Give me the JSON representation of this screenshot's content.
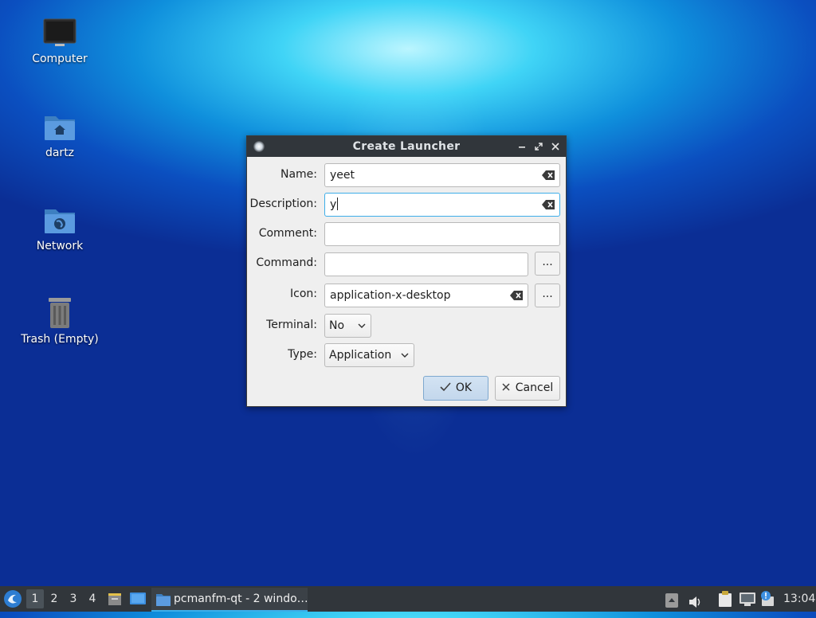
{
  "desktop": {
    "icons": [
      {
        "label": "Computer",
        "icon": "monitor-icon"
      },
      {
        "label": "dartz",
        "icon": "home-folder-icon"
      },
      {
        "label": "Network",
        "icon": "network-folder-icon"
      },
      {
        "label": "Trash (Empty)",
        "icon": "trash-icon"
      }
    ]
  },
  "dialog": {
    "title": "Create Launcher",
    "fields": {
      "name": {
        "label": "Name:",
        "value": "yeet"
      },
      "description": {
        "label": "Description:",
        "value": "y"
      },
      "comment": {
        "label": "Comment:",
        "value": ""
      },
      "command": {
        "label": "Command:",
        "value": "",
        "browse": "..."
      },
      "icon": {
        "label": "Icon:",
        "value": "application-x-desktop",
        "browse": "..."
      },
      "terminal": {
        "label": "Terminal:",
        "value": "No"
      },
      "type": {
        "label": "Type:",
        "value": "Application"
      }
    },
    "buttons": {
      "ok": "OK",
      "cancel": "Cancel"
    }
  },
  "taskbar": {
    "workspaces": [
      "1",
      "2",
      "3",
      "4"
    ],
    "active_workspace": "1",
    "task": "pcmanfm-qt - 2 windo…",
    "clock": "13:04"
  },
  "colors": {
    "accent": "#3daee9",
    "panel": "#31363b"
  }
}
